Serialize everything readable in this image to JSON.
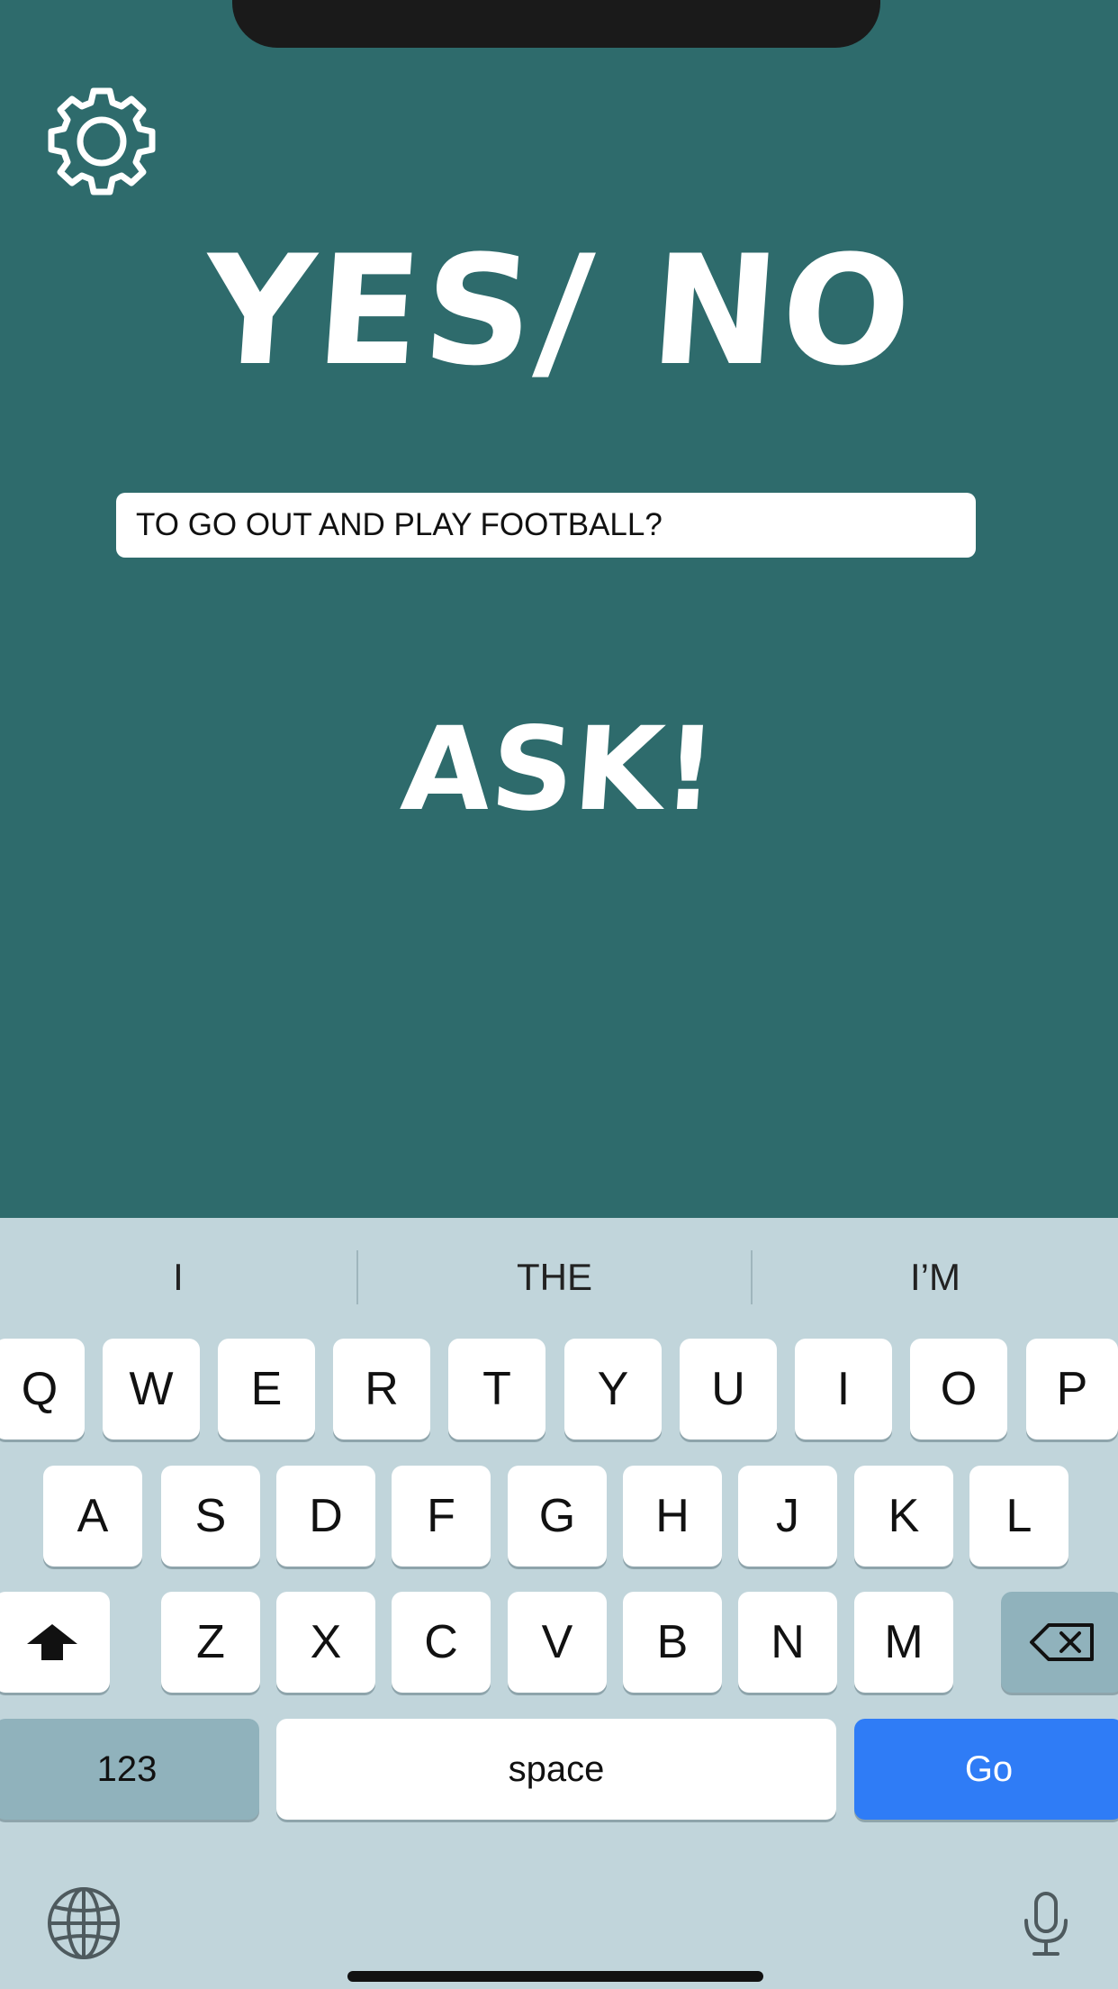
{
  "app": {
    "title": "YES/ NO",
    "question_value": "TO GO OUT AND PLAY FOOTBALL?",
    "ask_label": "ASK!"
  },
  "icons": {
    "settings": "gear-icon",
    "shift": "shift-icon",
    "backspace": "backspace-icon",
    "globe": "globe-icon",
    "microphone": "microphone-icon"
  },
  "keyboard": {
    "suggestions": [
      "I",
      "THE",
      "I’M"
    ],
    "row1": [
      "Q",
      "W",
      "E",
      "R",
      "T",
      "Y",
      "U",
      "I",
      "O",
      "P"
    ],
    "row2": [
      "A",
      "S",
      "D",
      "F",
      "G",
      "H",
      "J",
      "K",
      "L"
    ],
    "row3": [
      "Z",
      "X",
      "C",
      "V",
      "B",
      "N",
      "M"
    ],
    "numbers_label": "123",
    "space_label": "space",
    "go_label": "Go"
  },
  "colors": {
    "background": "#2e6b6c",
    "keyboard": "#c1d5db",
    "go_key": "#2f7cf6"
  }
}
